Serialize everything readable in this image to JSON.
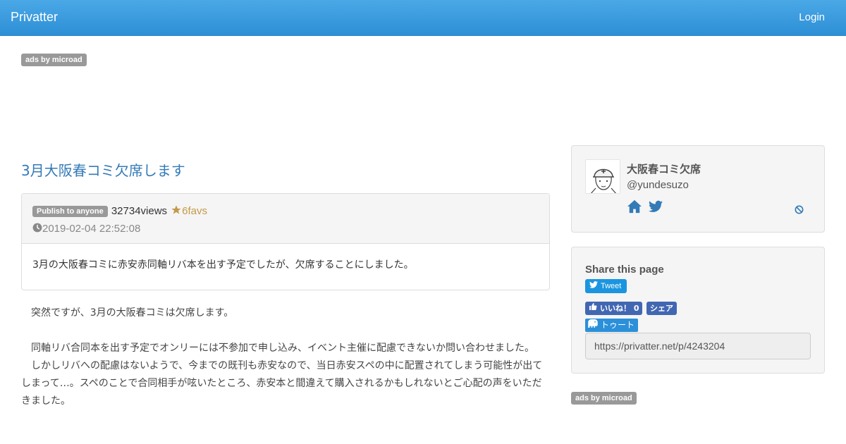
{
  "navbar": {
    "brand": "Privatter",
    "login_label": "Login"
  },
  "ads": {
    "top_label": "ads by microad",
    "side_label": "ads by microad"
  },
  "post": {
    "title": "3月大阪春コミ欠席します",
    "visibility_badge": "Publish to anyone",
    "views": "32734views",
    "favs": "6favs",
    "date": "2019-02-04 22:52:08",
    "summary": "3月の大阪春コミに赤安赤同軸リバ本を出す予定でしたが、欠席することにしました。",
    "paragraphs": [
      "　突然ですが、3月の大阪春コミは欠席します。",
      "",
      "　同軸リバ合同本を出す予定でオンリーには不参加で申し込み、イベント主催に配慮できないか問い合わせました。",
      "　しかしリバへの配慮はないようで、今までの既刊も赤安なので、当日赤安スペの中に配置されてしまう可能性が出てしまって…。スペのことで合同相手が呟いたところ、赤安本と間違えて購入されるかもしれないとご心配の声をいただきました。"
    ]
  },
  "profile": {
    "display_name": "大阪春コミ欠席",
    "handle": "@yundesuzo",
    "icons": [
      "home-icon",
      "twitter-icon",
      "block-icon"
    ]
  },
  "share": {
    "title": "Share this page",
    "tweet_label": "Tweet",
    "fb_like_label": "いいね！ 0",
    "fb_share_label": "シェア",
    "toot_label": "トゥート",
    "url_value": "https://privatter.net/p/4243204"
  },
  "colors": {
    "navbar": "#2d8fd6",
    "link": "#337ab7",
    "favs": "#c49a48",
    "twitter": "#1b95e0",
    "facebook": "#4267b2",
    "mastodon": "#2b90d9"
  }
}
